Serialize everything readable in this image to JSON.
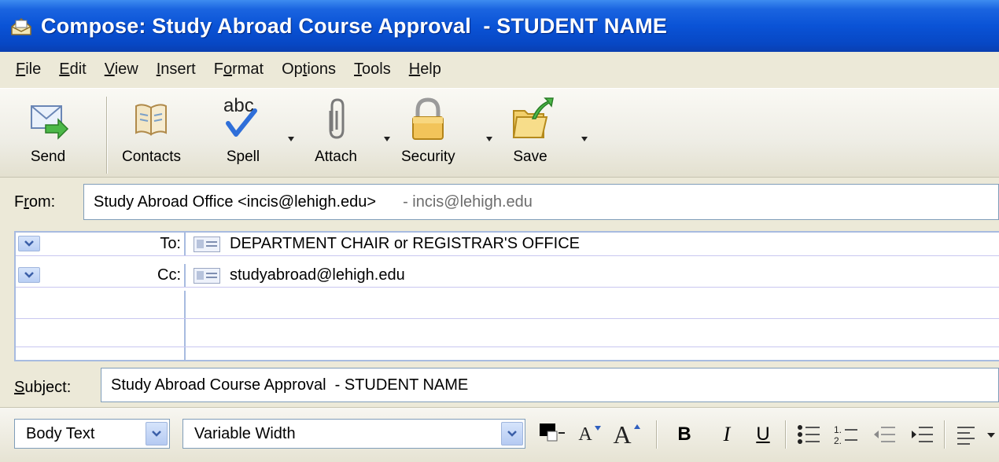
{
  "window": {
    "title": "Compose: Study Abroad Course Approval  - STUDENT NAME"
  },
  "menu": {
    "items": [
      {
        "label": "File",
        "mnemonic": "F",
        "rest": "ile"
      },
      {
        "label": "Edit",
        "mnemonic": "E",
        "rest": "dit"
      },
      {
        "label": "View",
        "mnemonic": "V",
        "rest": "iew"
      },
      {
        "label": "Insert",
        "mnemonic": "I",
        "rest": "nsert"
      },
      {
        "pre": "F",
        "mnemonic": "o",
        "rest": "rmat",
        "label": "Format"
      },
      {
        "pre": "Op",
        "mnemonic": "t",
        "rest": "ions",
        "label": "Options"
      },
      {
        "label": "Tools",
        "mnemonic": "T",
        "rest": "ools"
      },
      {
        "label": "Help",
        "mnemonic": "H",
        "rest": "elp"
      }
    ]
  },
  "toolbar": {
    "send": "Send",
    "contacts": "Contacts",
    "spell": "Spell",
    "spell_icon_text": "abc",
    "attach": "Attach",
    "security": "Security",
    "save": "Save"
  },
  "header": {
    "from_label": "From:",
    "from_mnemonic": "r",
    "from_value": "Study Abroad Office <incis@lehigh.edu>",
    "from_extra": "- incis@lehigh.edu",
    "recipients": [
      {
        "type": "To:",
        "value": "DEPARTMENT CHAIR or REGISTRAR'S OFFICE"
      },
      {
        "type": "Cc:",
        "value": "studyabroad@lehigh.edu"
      }
    ],
    "subject_label": "Subject:",
    "subject_mnemonic": "S",
    "subject_rest": "ubject:",
    "subject_value": "Study Abroad Course Approval  - STUDENT NAME"
  },
  "format": {
    "paragraph_style": "Body Text",
    "font": "Variable Width",
    "bold": "B",
    "italic": "I",
    "underline": "U",
    "smaller": "A",
    "larger": "A"
  },
  "colors": {
    "titlebar": "#0a53d6",
    "background": "#ece9d8",
    "field_border": "#7f9db9",
    "recipient_border": "#a7bbe0"
  }
}
